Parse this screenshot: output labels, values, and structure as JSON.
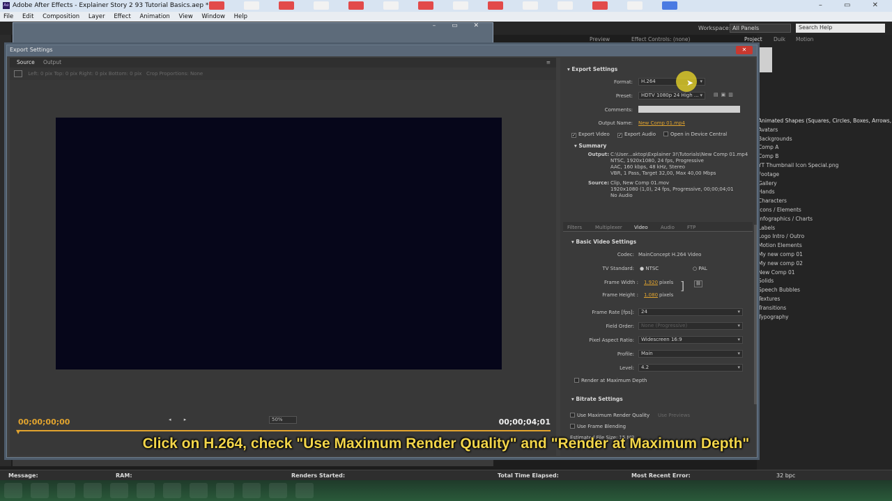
{
  "window": {
    "title": "Adobe After Effects - Explainer Story 2 93 Tutorial Basics.aep *",
    "app_icon": "Ae",
    "controls": "– ▭ ✕"
  },
  "menu": [
    "File",
    "Edit",
    "Composition",
    "Layer",
    "Effect",
    "Animation",
    "View",
    "Window",
    "Help"
  ],
  "ae_toolbar": {
    "workspace_label": "Workspace:",
    "workspace_value": "All Panels",
    "search_placeholder": "Search Help"
  },
  "right_panel": {
    "tabs": [
      "Preview",
      "Effect Controls: (none)",
      "Project",
      "Duik",
      "Motion"
    ],
    "project_items": [
      "Animated Shapes (Squares, Circles, Boxes, Arrows, ...",
      "Avatars",
      "Backgrounds",
      "Comp A",
      "Comp B",
      "YT Thumbnail Icon Special.png",
      "Footage",
      "Gallery",
      "Hands",
      "Characters",
      "Icons / Elements",
      "Infographics / Charts",
      "Labels",
      "Logo Intro / Outro",
      "Motion Elements",
      "My new comp 01",
      "My new comp 02",
      "New Comp 01",
      "Solids",
      "Speech Bubbles",
      "Textures",
      "Transitions",
      "Typography"
    ]
  },
  "dialog": {
    "title": "Export Settings",
    "close_label": "✕",
    "source_tab": "Source",
    "output_tab": "Output",
    "crop": {
      "left": "Left:",
      "left_v": "0",
      "px1": "pix",
      "top": "Top:",
      "top_v": "0",
      "px2": "pix",
      "right": "Right:",
      "right_v": "0",
      "px3": "pix",
      "bottom": "Bottom:",
      "bottom_v": "0",
      "px4": "pix",
      "proportions": "Crop Proportions:",
      "proportions_v": "None"
    },
    "timecode_start": "00;00;00;00",
    "timecode_end": "00;00;04;01",
    "zoom": "50%",
    "export_settings": {
      "header": "Export Settings",
      "format_label": "Format:",
      "format_value": "H.264",
      "preset_label": "Preset:",
      "preset_value": "HDTV 1080p 24 High ...",
      "comments_label": "Comments:",
      "output_name_label": "Output Name:",
      "output_name_value": "New Comp 01.mp4",
      "export_video": "Export Video",
      "export_audio": "Export Audio",
      "open_device_central": "Open in Device Central"
    },
    "summary": {
      "header": "Summary",
      "output_label": "Output:",
      "output_lines": [
        "C:\\User...aktop\\Explainer 3!\\Tutorials\\New Comp 01.mp4",
        "NTSC, 1920x1080, 24 fps, Progressive",
        "AAC, 160 kbps, 48 kHz, Stereo",
        "VBR, 1 Pass, Target 32,00, Max 40,00 Mbps"
      ],
      "source_label": "Source:",
      "source_lines": [
        "Clip, New Comp 01.mov",
        "1920x1080 (1,0), 24 fps, Progressive, 00;00;04;01",
        "No Audio"
      ]
    },
    "tabs": [
      "Filters",
      "Multiplexer",
      "Video",
      "Audio",
      "FTP"
    ],
    "basic_video": {
      "header": "Basic Video Settings",
      "codec_label": "Codec:",
      "codec_value": "MainConcept H.264 Video",
      "tv_label": "TV Standard:",
      "ntsc": "NTSC",
      "pal": "PAL",
      "fw_label": "Frame Width :",
      "fw_value": "1.920",
      "fh_label": "Frame Height :",
      "fh_value": "1.080",
      "pixels": "pixels",
      "fps_label": "Frame Rate [fps]:",
      "fps_value": "24",
      "field_label": "Field Order:",
      "field_value": "None (Progressive)",
      "par_label": "Pixel Aspect Ratio:",
      "par_value": "Widescreen 16:9",
      "profile_label": "Profile:",
      "profile_value": "Main",
      "level_label": "Level:",
      "level_value": "4.2",
      "render_max_depth": "Render at Maximum Depth"
    },
    "bitrate": {
      "header": "Bitrate Settings"
    },
    "use_max_quality": "Use Maximum Render Quality",
    "use_previews": "Use Previews",
    "use_frame_blending": "Use Frame Blending",
    "file_size": "Estimated File Size: 15 MB"
  },
  "caption": "Click on H.264, check \"Use Maximum Render Quality\" and \"Render at Maximum Depth\"",
  "status": {
    "message": "Message:",
    "ram": "RAM:",
    "renders_started": "Renders Started:",
    "total_time": "Total Time Elapsed:",
    "recent_error": "Most Recent Error:",
    "bpc": "32 bpc"
  },
  "colors": {
    "accent": "#e2a42e",
    "caption": "#f2d54a",
    "close": "#c8382f"
  }
}
